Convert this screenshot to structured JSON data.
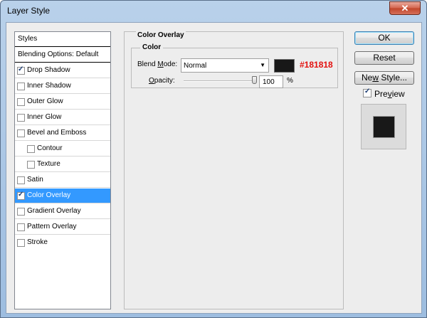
{
  "window": {
    "title": "Layer Style",
    "close_glyph": "✕"
  },
  "styles_list": {
    "header": "Styles",
    "blending_options": "Blending Options: Default",
    "items": [
      {
        "label": "Drop Shadow",
        "checked": true
      },
      {
        "label": "Inner Shadow",
        "checked": false
      },
      {
        "label": "Outer Glow",
        "checked": false
      },
      {
        "label": "Inner Glow",
        "checked": false
      },
      {
        "label": "Bevel and Emboss",
        "checked": false
      },
      {
        "label": "Contour",
        "checked": false
      },
      {
        "label": "Texture",
        "checked": false
      },
      {
        "label": "Satin",
        "checked": false
      },
      {
        "label": "Color Overlay",
        "checked": true,
        "selected": true
      },
      {
        "label": "Gradient Overlay",
        "checked": false
      },
      {
        "label": "Pattern Overlay",
        "checked": false
      },
      {
        "label": "Stroke",
        "checked": false
      }
    ]
  },
  "color_overlay": {
    "section_title": "Color Overlay",
    "group_title": "Color",
    "blend_mode_label_pre": "Blend ",
    "blend_mode_label_key": "M",
    "blend_mode_label_post": "ode:",
    "blend_mode_value": "Normal",
    "dropdown_arrow": "▼",
    "swatch_color": "#181818",
    "annotation_hex": "#181818",
    "annotation_color": "#e3100e",
    "opacity_label_key": "O",
    "opacity_label_post": "pacity:",
    "opacity_value": "100",
    "opacity_unit": "%"
  },
  "buttons": {
    "ok": "OK",
    "reset": "Reset",
    "new_style_pre": "Ne",
    "new_style_key": "w",
    "new_style_post": " Style...",
    "preview_label_pre": "Pre",
    "preview_label_key": "v",
    "preview_label_post": "iew",
    "preview_checked": true
  },
  "preview": {
    "fill_color": "#181818"
  },
  "colors": {
    "selection": "#3399ff",
    "dialog_bg": "#ededed"
  }
}
